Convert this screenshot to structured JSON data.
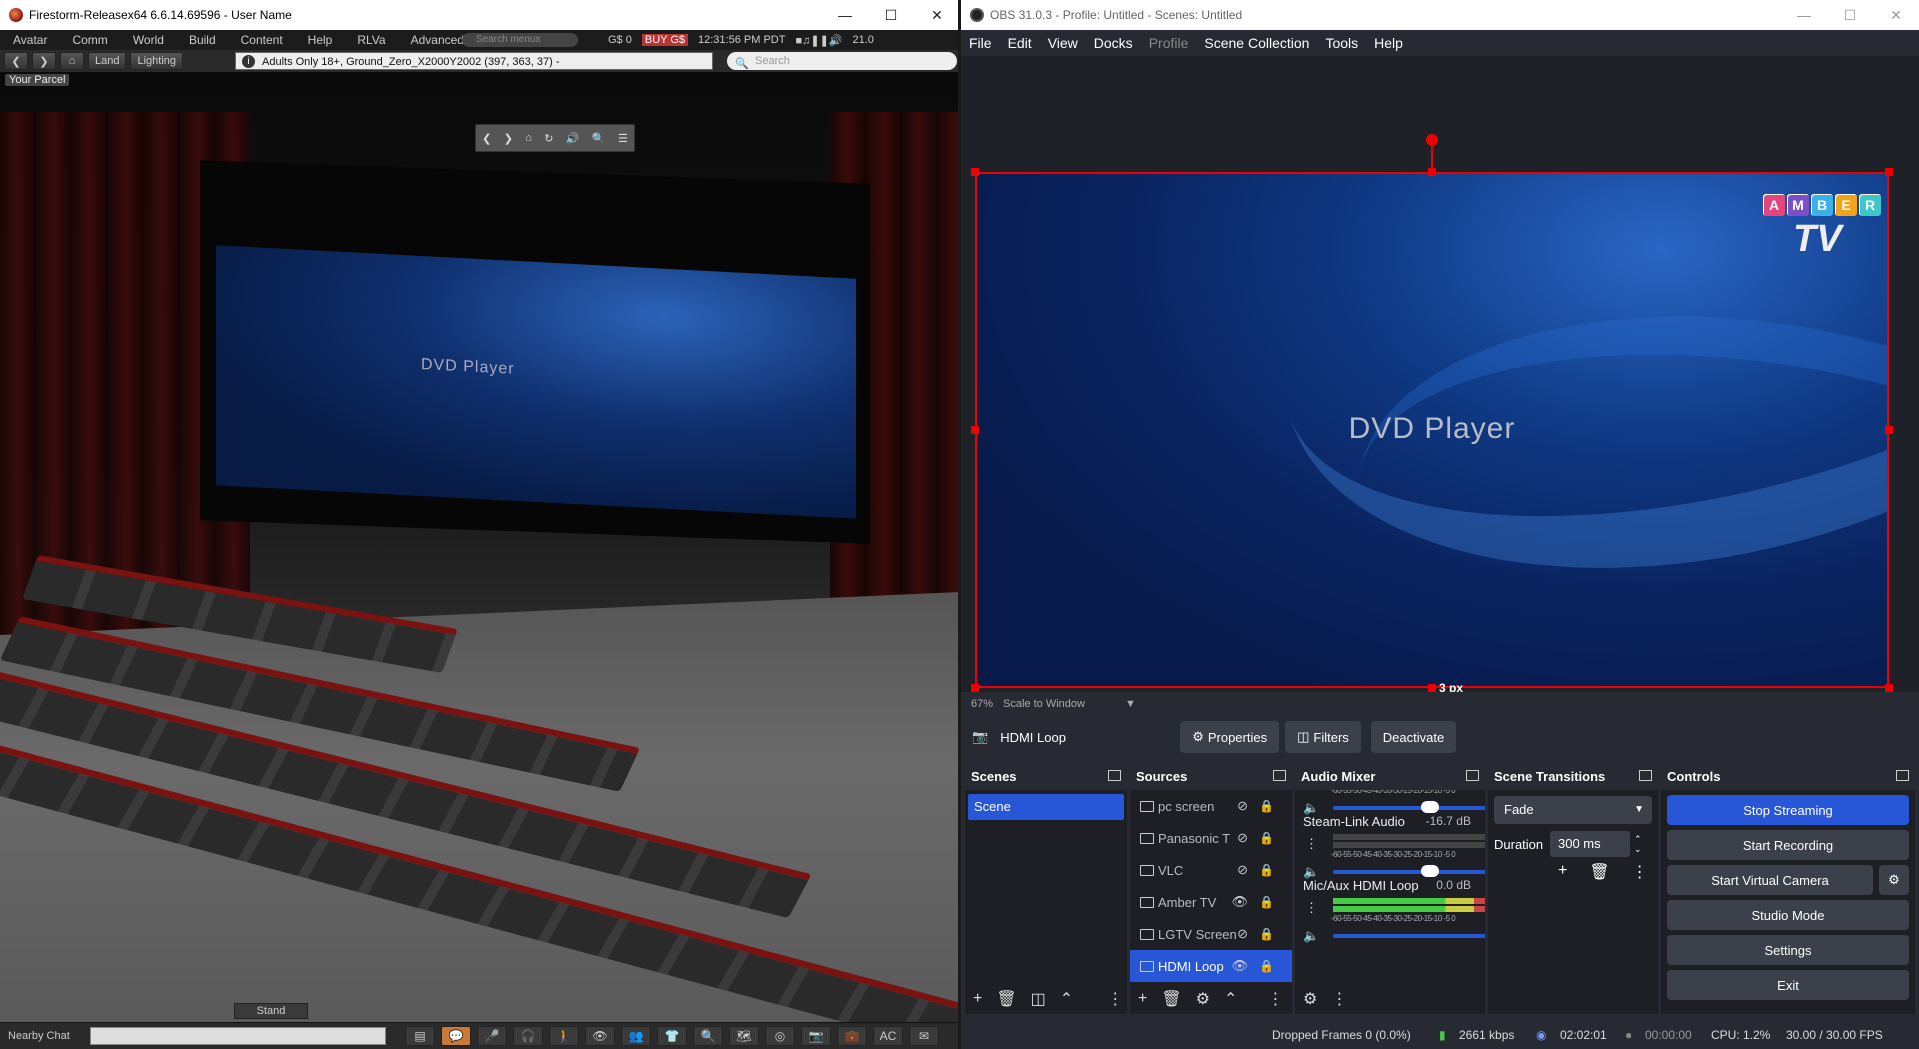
{
  "firestorm": {
    "window_title": "Firestorm-Releasex64 6.6.14.69596 - User Name",
    "menu": [
      "Avatar",
      "Comm",
      "World",
      "Build",
      "Content",
      "Help",
      "RLVa",
      "Advanced"
    ],
    "menu_search_placeholder": "Search menus",
    "balance": "G$ 0",
    "buy_label": "BUY G$",
    "clock": "12:31:56 PM PDT",
    "fps": "21.0",
    "nav_land": "Land",
    "nav_lighting": "Lighting",
    "location": "Adults Only 18+, Ground_Zero_X2000Y2002 (397, 363, 37) -",
    "search_placeholder": "Search",
    "parcel_label": "Your Parcel",
    "screen_text": "DVD Player",
    "stand_label": "Stand",
    "nearby_chat_label": "Nearby Chat",
    "toolbar_ac": "AC"
  },
  "obs": {
    "window_title": "OBS 31.0.3 - Profile: Untitled - Scenes: Untitled",
    "menu": {
      "file": "File",
      "edit": "Edit",
      "view": "View",
      "docks": "Docks",
      "profile": "Profile",
      "scene_collection": "Scene Collection",
      "tools": "Tools",
      "help": "Help"
    },
    "preview_text": "DVD Player",
    "logo_letters": [
      "A",
      "M",
      "B",
      "E",
      "R"
    ],
    "logo_colors": [
      "#e4447f",
      "#7a4fc8",
      "#3ab1e8",
      "#f0a31b",
      "#3fc7c7"
    ],
    "logo_tv": "TV",
    "distance_label": "3 px",
    "zoom": "67%",
    "zoom_mode": "Scale to Window",
    "selected_source": "HDMI Loop",
    "properties_label": "Properties",
    "filters_label": "Filters",
    "deactivate_label": "Deactivate",
    "scenes": {
      "title": "Scenes",
      "items": [
        "Scene"
      ]
    },
    "sources": {
      "title": "Sources",
      "items": [
        {
          "name": "pc screen",
          "visible": false,
          "icon": "monitor-icon"
        },
        {
          "name": "Panasonic T",
          "visible": false,
          "icon": "monitor-icon"
        },
        {
          "name": "VLC",
          "visible": false,
          "icon": "vlc-icon"
        },
        {
          "name": "Amber TV",
          "visible": true,
          "icon": "image-icon"
        },
        {
          "name": "LGTV Screen",
          "visible": false,
          "icon": "monitor-icon"
        },
        {
          "name": "HDMI Loop",
          "visible": true,
          "icon": "camera-icon"
        }
      ]
    },
    "mixer": {
      "title": "Audio Mixer",
      "scale": "-60-55-50-45-40-35-30-25-20-15-10 -5  0",
      "channels": [
        {
          "name": "",
          "level": "",
          "muted": true,
          "volume": 0.6
        },
        {
          "name": "Steam-Link Audio",
          "level": "-16.7 dB",
          "muted": true,
          "volume": 0.6
        },
        {
          "name": "Mic/Aux HDMI Loop",
          "level": "0.0 dB",
          "muted": false,
          "volume": 1.0
        }
      ]
    },
    "transitions": {
      "title": "Scene Transitions",
      "selected": "Fade",
      "duration_label": "Duration",
      "duration_value": "300 ms"
    },
    "controls": {
      "title": "Controls",
      "stop_streaming": "Stop Streaming",
      "start_recording": "Start Recording",
      "start_virtual_camera": "Start Virtual Camera",
      "studio_mode": "Studio Mode",
      "settings": "Settings",
      "exit": "Exit"
    },
    "status": {
      "dropped_frames": "Dropped Frames 0 (0.0%)",
      "bitrate": "2661 kbps",
      "stream_time": "02:02:01",
      "record_time": "00:00:00",
      "cpu": "CPU: 1.2%",
      "fps": "30.00 / 30.00 FPS"
    },
    "accent_color": "#2757d6",
    "selection_color": "#e00000"
  }
}
